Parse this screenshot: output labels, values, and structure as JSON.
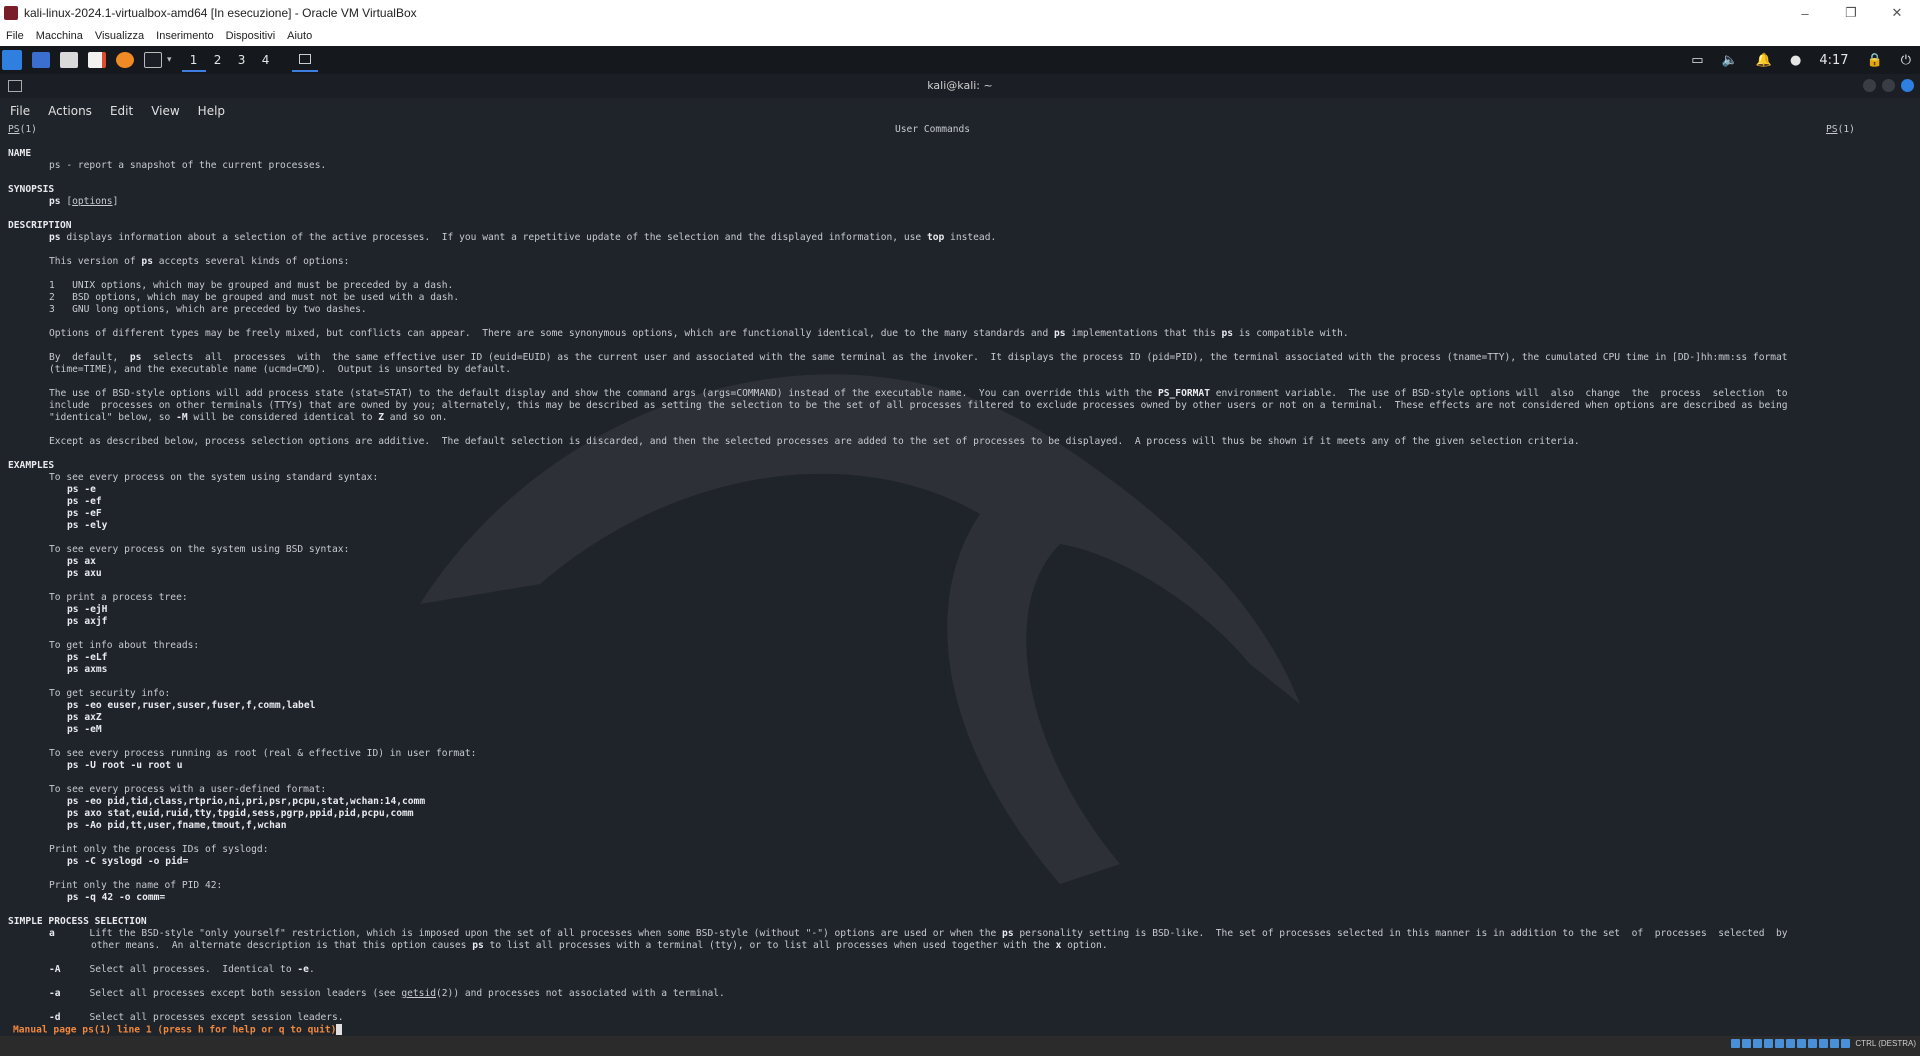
{
  "vbox": {
    "title": "kali-linux-2024.1-virtualbox-amd64 [In esecuzione] - Oracle VM VirtualBox",
    "menu": [
      "File",
      "Macchina",
      "Visualizza",
      "Inserimento",
      "Dispositivi",
      "Aiuto"
    ],
    "window_controls": [
      "–",
      "❐",
      "✕"
    ]
  },
  "kali_panel": {
    "workspaces": [
      "1",
      "2",
      "3",
      "4"
    ],
    "clock": "4:17",
    "icons": [
      "kali-menu-icon",
      "desktop-icon",
      "files-icon",
      "editor-icon",
      "firefox-icon",
      "terminal-icon"
    ]
  },
  "terminal": {
    "title": "kali@kali: ~",
    "menu": [
      "File",
      "Actions",
      "Edit",
      "View",
      "Help"
    ]
  },
  "man": {
    "header_left": "PS",
    "header_left_sec": "(1)",
    "header_center": "User Commands",
    "header_right": "PS",
    "header_right_sec": "(1)",
    "status": "Manual page ps(1) line 1 (press h for help or q to quit)"
  },
  "taskbar": {
    "tray_label": "CTRL (DESTRA)"
  },
  "colors": {
    "status": "#f0883e",
    "accent": "#3d7ee0",
    "background": "#1f232a"
  }
}
